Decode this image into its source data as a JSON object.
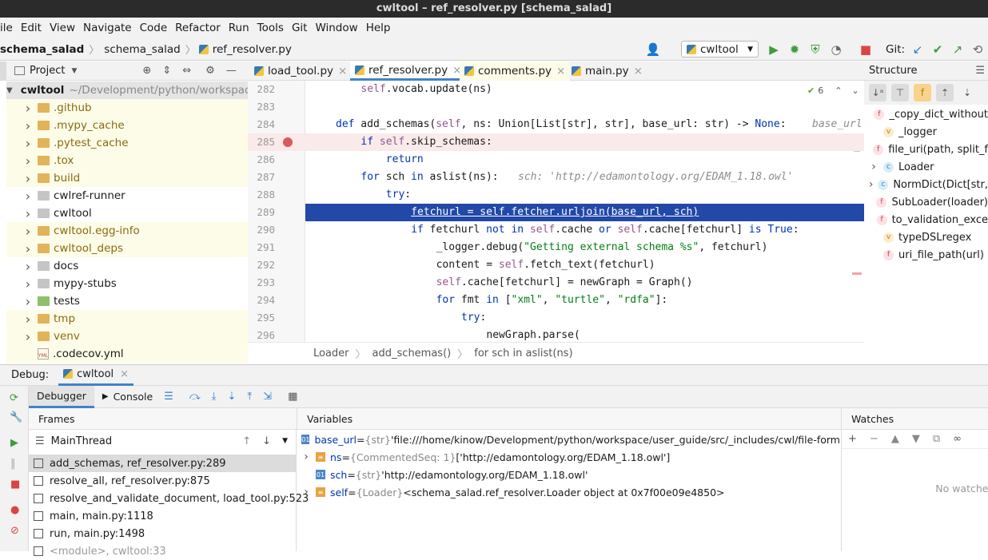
{
  "window_title": "cwltool – ref_resolver.py [schema_salad]",
  "menu": [
    "ile",
    "Edit",
    "View",
    "Navigate",
    "Code",
    "Refactor",
    "Run",
    "Tools",
    "Git",
    "Window",
    "Help"
  ],
  "breadcrumbs": [
    "schema_salad",
    "schema_salad",
    "ref_resolver.py"
  ],
  "run_config": "cwltool",
  "git_label": "Git:",
  "project": {
    "header": "Project",
    "root_name": "cwltool",
    "root_path": "~/Development/python/workspace",
    "items": [
      {
        "label": ".github",
        "type": "folder",
        "color": "orange"
      },
      {
        "label": ".mypy_cache",
        "type": "folder",
        "color": "orange"
      },
      {
        "label": ".pytest_cache",
        "type": "folder",
        "color": "orange"
      },
      {
        "label": ".tox",
        "type": "folder",
        "color": "orange"
      },
      {
        "label": "build",
        "type": "folder",
        "color": "orange"
      },
      {
        "label": "cwlref-runner",
        "type": "folder",
        "color": "gray"
      },
      {
        "label": "cwltool",
        "type": "folder",
        "color": "gray"
      },
      {
        "label": "cwltool.egg-info",
        "type": "folder",
        "color": "orange"
      },
      {
        "label": "cwltool_deps",
        "type": "folder",
        "color": "orange"
      },
      {
        "label": "docs",
        "type": "folder",
        "color": "gray"
      },
      {
        "label": "mypy-stubs",
        "type": "folder",
        "color": "gray"
      },
      {
        "label": "tests",
        "type": "folder",
        "color": "green"
      },
      {
        "label": "tmp",
        "type": "folder",
        "color": "orange"
      },
      {
        "label": "venv",
        "type": "folder",
        "color": "orange"
      },
      {
        "label": ".codecov.yml",
        "type": "file",
        "color": "gray"
      }
    ]
  },
  "tabs": [
    {
      "label": "load_tool.py"
    },
    {
      "label": "ref_resolver.py"
    },
    {
      "label": "comments.py"
    },
    {
      "label": "main.py"
    }
  ],
  "editor": {
    "warnings_count": "6",
    "lines": [
      {
        "num": "282",
        "indent": 4,
        "code": "self.vocab.update(ns)"
      },
      {
        "num": "283",
        "indent": 0,
        "code": ""
      },
      {
        "num": "284",
        "indent": 0,
        "code": "def add_schemas(self, ns: Union[List[str], str], base_url: str) -> None:",
        "hint": "base_url"
      },
      {
        "num": "285",
        "indent": 4,
        "code": "if self.skip_schemas:"
      },
      {
        "num": "286",
        "indent": 8,
        "code": "return"
      },
      {
        "num": "287",
        "indent": 4,
        "code": "for sch in aslist(ns):",
        "hint": "sch: 'http://edamontology.org/EDAM_1.18.owl'"
      },
      {
        "num": "288",
        "indent": 8,
        "code": "try:"
      },
      {
        "num": "289",
        "indent": 12,
        "code": "fetchurl = self.fetcher.urljoin(base_url, sch)"
      },
      {
        "num": "290",
        "indent": 12,
        "code": "if fetchurl not in self.cache or self.cache[fetchurl] is True:"
      },
      {
        "num": "291",
        "indent": 16,
        "code": "_logger.debug(\"Getting external schema %s\", fetchurl)"
      },
      {
        "num": "292",
        "indent": 16,
        "code": "content = self.fetch_text(fetchurl)"
      },
      {
        "num": "293",
        "indent": 16,
        "code": "self.cache[fetchurl] = newGraph = Graph()"
      },
      {
        "num": "294",
        "indent": 16,
        "code": "for fmt in [\"xml\", \"turtle\", \"rdfa\"]:"
      },
      {
        "num": "295",
        "indent": 20,
        "code": "try:"
      },
      {
        "num": "296",
        "indent": 24,
        "code": "newGraph.parse("
      }
    ],
    "breadcrumb": [
      "Loader",
      "add_schemas()",
      "for sch in aslist(ns)"
    ]
  },
  "structure": {
    "header": "Structure",
    "items": [
      {
        "label": "_copy_dict_without",
        "kind": "f",
        "expand": false
      },
      {
        "label": "_logger",
        "kind": "v",
        "expand": false
      },
      {
        "label": "file_uri(path, split_f",
        "kind": "f",
        "expand": false
      },
      {
        "label": "Loader",
        "kind": "c",
        "expand": true
      },
      {
        "label": "NormDict(Dict[str,",
        "kind": "c",
        "expand": true
      },
      {
        "label": "SubLoader(loader)",
        "kind": "f",
        "expand": false
      },
      {
        "label": "to_validation_exce",
        "kind": "f",
        "expand": false
      },
      {
        "label": "typeDSLregex",
        "kind": "v",
        "expand": false
      },
      {
        "label": "uri_file_path(url)",
        "kind": "f",
        "expand": false
      }
    ]
  },
  "debug": {
    "label": "Debug:",
    "session": "cwltool",
    "tabs": [
      "Debugger",
      "Console"
    ],
    "frames_header": "Frames",
    "thread": "MainThread",
    "frames": [
      "add_schemas, ref_resolver.py:289",
      "resolve_all, ref_resolver.py:875",
      "resolve_and_validate_document, load_tool.py:523",
      "main, main.py:1118",
      "run, main.py:1498",
      "<module>, cwltool:33"
    ],
    "variables_header": "Variables",
    "variables": [
      {
        "name": "base_url",
        "type": "{str}",
        "value": "'file:///home/kinow/Development/python/workspace/user_guide/src/_includes/cwl/file-form",
        "expand": false,
        "icon": "01"
      },
      {
        "name": "ns",
        "type": "{CommentedSeq: 1}",
        "value": "['http://edamontology.org/EDAM_1.18.owl']",
        "expand": true,
        "icon": "list"
      },
      {
        "name": "sch",
        "type": "{str}",
        "value": "'http://edamontology.org/EDAM_1.18.owl'",
        "expand": false,
        "icon": "01"
      },
      {
        "name": "self",
        "type": "{Loader}",
        "value": "<schema_salad.ref_resolver.Loader object at 0x7f00e09e4850>",
        "expand": true,
        "icon": "list"
      }
    ],
    "watches_header": "Watches",
    "no_watches": "No watches"
  },
  "colors": {
    "accent": "#2f65ca",
    "selection": "#2248a8",
    "breakpoint": "#db5860",
    "breakpoint_line": "#faeaea"
  }
}
